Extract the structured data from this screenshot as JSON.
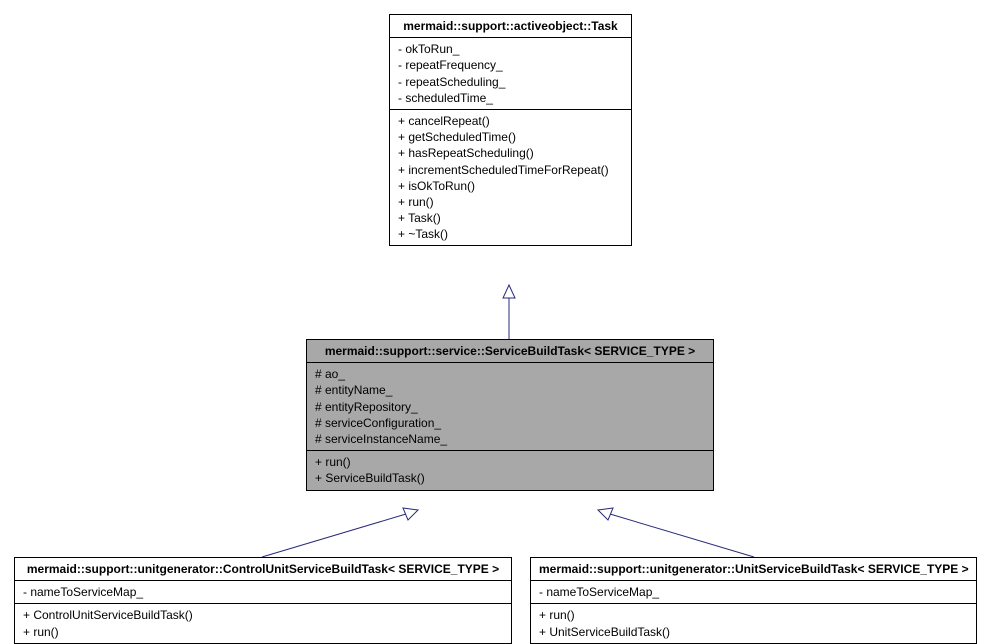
{
  "chart_data": {
    "type": "uml_class_diagram",
    "classes": [
      {
        "id": "task",
        "name": "mermaid::support::activeobject::Task",
        "attributes": [
          "- okToRun_",
          "- repeatFrequency_",
          "- repeatScheduling_",
          "- scheduledTime_"
        ],
        "methods": [
          "+ cancelRepeat()",
          "+ getScheduledTime()",
          "+ hasRepeatScheduling()",
          "+ incrementScheduledTimeForRepeat()",
          "+ isOkToRun()",
          "+ run()",
          "+ Task()",
          "+ ~Task()"
        ]
      },
      {
        "id": "servicebuild",
        "name": "mermaid::support::service::ServiceBuildTask< SERVICE_TYPE >",
        "attributes": [
          "# ao_",
          "# entityName_",
          "# entityRepository_",
          "# serviceConfiguration_",
          "# serviceInstanceName_"
        ],
        "methods": [
          "+ run()",
          "+ ServiceBuildTask()"
        ]
      },
      {
        "id": "control",
        "name": "mermaid::support::unitgenerator::ControlUnitServiceBuildTask< SERVICE_TYPE >",
        "attributes": [
          "- nameToServiceMap_"
        ],
        "methods": [
          "+ ControlUnitServiceBuildTask()",
          "+ run()"
        ]
      },
      {
        "id": "unit",
        "name": "mermaid::support::unitgenerator::UnitServiceBuildTask< SERVICE_TYPE >",
        "attributes": [
          "- nameToServiceMap_"
        ],
        "methods": [
          "+ run()",
          "+ UnitServiceBuildTask()"
        ]
      }
    ],
    "inheritance": [
      {
        "from": "servicebuild",
        "to": "task"
      },
      {
        "from": "control",
        "to": "servicebuild"
      },
      {
        "from": "unit",
        "to": "servicebuild"
      }
    ]
  }
}
